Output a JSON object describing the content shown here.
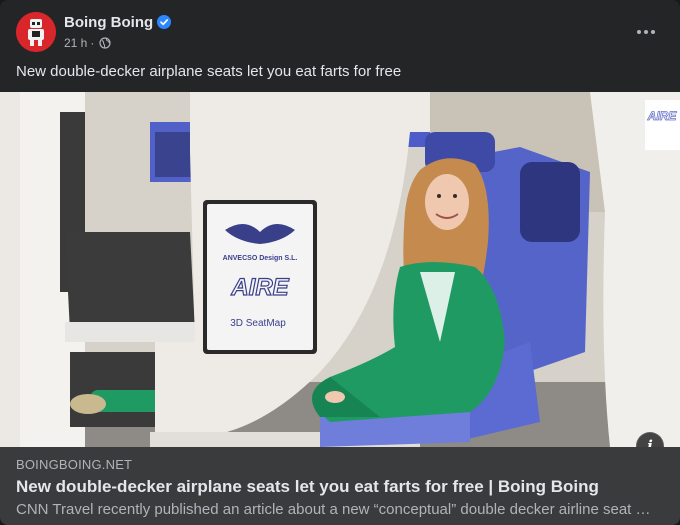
{
  "post": {
    "page_name": "Boing Boing",
    "timestamp": "21 h",
    "separator": "·",
    "text": "New double-decker airplane seats let you eat farts for free"
  },
  "image": {
    "placard_brand": "ANVECSO Design S.L.",
    "placard_product": "AIRE",
    "placard_footer": "3D SeatMap",
    "side_panel_text": "AIRE",
    "info_label": "i"
  },
  "link_preview": {
    "domain": "BOINGBOING.NET",
    "title": "New double-decker airplane seats let you eat farts for free | Boing Boing",
    "description": "CNN Travel recently published an article about a new “conceptual” double decker airline seat …"
  },
  "icons": {
    "avatar": "boing-boing-avatar-icon",
    "verified": "verified-badge-icon",
    "privacy": "globe-icon",
    "more": "more-options-icon",
    "info": "info-icon"
  },
  "colors": {
    "background": "#242526",
    "link_preview_bg": "#3a3b3c",
    "primary_text": "#e4e6eb",
    "secondary_text": "#b0b3b8",
    "verified_blue": "#2d88ff",
    "avatar_red": "#d8262b",
    "jacket_green": "#1f9a63"
  }
}
